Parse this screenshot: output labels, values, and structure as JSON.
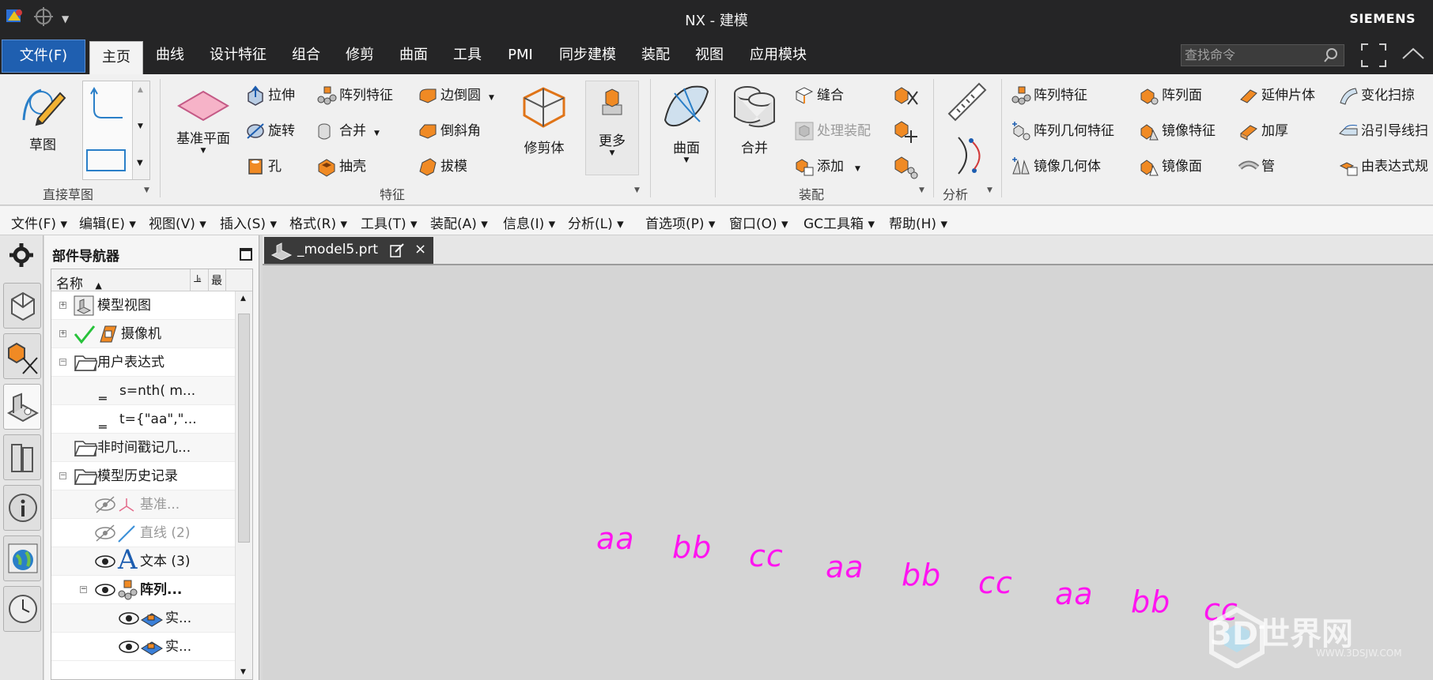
{
  "window": {
    "title": "NX - 建模",
    "brand": "SIEMENS"
  },
  "ribbon_tabs": [
    "文件(F)",
    "主页",
    "曲线",
    "设计特征",
    "组合",
    "修剪",
    "曲面",
    "工具",
    "PMI",
    "同步建模",
    "装配",
    "视图",
    "应用模块"
  ],
  "search": {
    "placeholder": "查找命令"
  },
  "ribbon": {
    "sketch": {
      "label": "草图",
      "group": "直接草图"
    },
    "feature": {
      "group": "特征",
      "datum_plane": "基准平面",
      "extrude": "拉伸",
      "revolve": "旋转",
      "hole": "孔",
      "pattern_feature": "阵列特征",
      "unite": "合并",
      "shell": "抽壳",
      "edge_blend": "边倒圆",
      "chamfer": "倒斜角",
      "draft": "拔模",
      "trim_body": "修剪体",
      "more": "更多"
    },
    "surface": {
      "label": "曲面"
    },
    "assembly": {
      "group": "装配",
      "merge": "合并",
      "sew": "缝合",
      "process_assembly": "处理装配",
      "add": "添加"
    },
    "analysis": {
      "group": "分析"
    },
    "right": {
      "pattern_feature": "阵列特征",
      "pattern_geometry": "阵列几何特征",
      "mirror_geometry": "镜像几何体",
      "pattern_face": "阵列面",
      "mirror_feature": "镜像特征",
      "mirror_face": "镜像面",
      "extend_sheet": "延伸片体",
      "thicken": "加厚",
      "tube": "管",
      "variational_sweep": "变化扫掠",
      "sweep_along_guide": "沿引导线扫",
      "law_curve": "由表达式规"
    }
  },
  "menubar": [
    "文件(F)",
    "编辑(E)",
    "视图(V)",
    "插入(S)",
    "格式(R)",
    "工具(T)",
    "装配(A)",
    "信息(I)",
    "分析(L)",
    "首选项(P)",
    "窗口(O)",
    "GC工具箱",
    "帮助(H)"
  ],
  "navigator": {
    "title": "部件导航器",
    "column_name": "名称",
    "rows": [
      {
        "label": "模型视图",
        "indent": 0
      },
      {
        "label": "摄像机",
        "indent": 0
      },
      {
        "label": "用户表达式",
        "indent": 0
      },
      {
        "label": "s=nth( m...",
        "indent": 1
      },
      {
        "label": "t={\"aa\",\"...",
        "indent": 1
      },
      {
        "label": "非时间戳记几...",
        "indent": 0
      },
      {
        "label": "模型历史记录",
        "indent": 0
      },
      {
        "label": "基准...",
        "indent": 1
      },
      {
        "label": "直线 (2)",
        "indent": 1
      },
      {
        "label": "文本 (3)",
        "indent": 1
      },
      {
        "label": "阵列...",
        "indent": 1
      },
      {
        "label": "实...",
        "indent": 2
      },
      {
        "label": "实...",
        "indent": 2
      }
    ]
  },
  "document_tab": {
    "name": "_model5.prt"
  },
  "viewport_text": [
    "aa",
    "bb",
    "cc",
    "aa",
    "bb",
    "cc",
    "aa",
    "bb",
    "cc"
  ],
  "watermark": {
    "text": "3D世界网",
    "sub": "WWW.3DSJW.COM"
  },
  "colors": {
    "accent": "#1f5fb0",
    "text_magenta": "#ff14f0",
    "dark_bar": "#252526"
  }
}
